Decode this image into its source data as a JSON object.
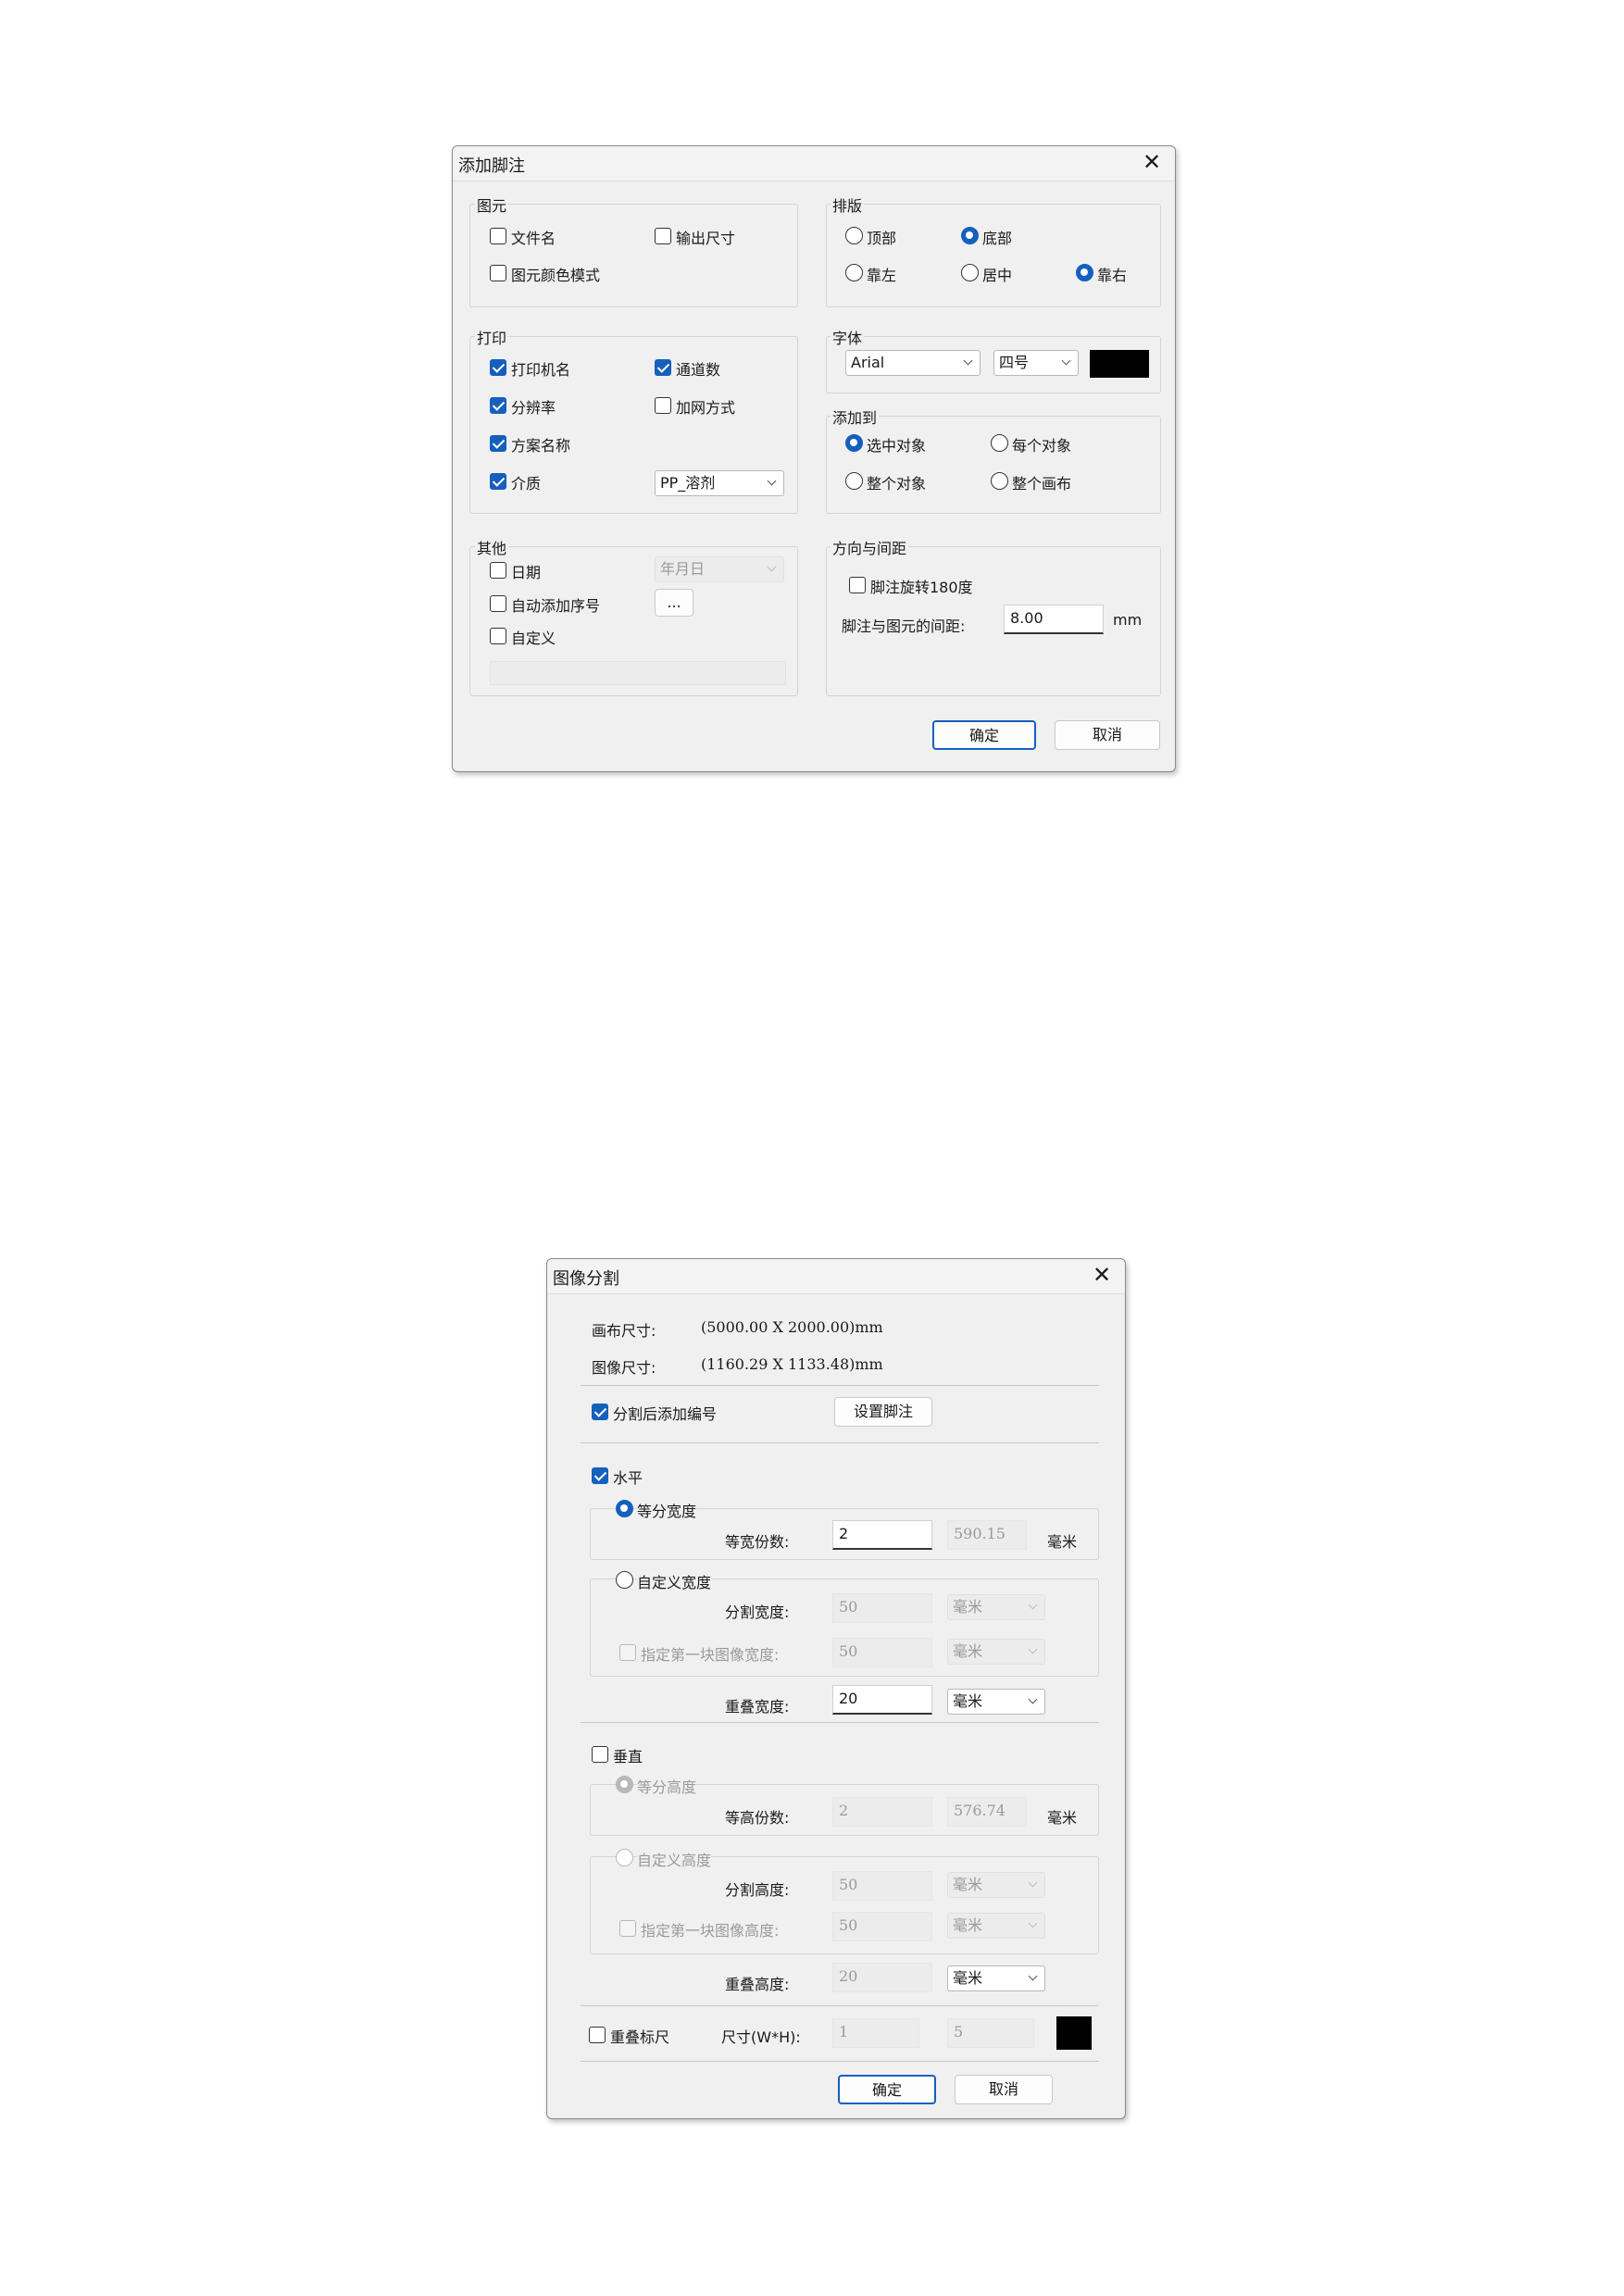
{
  "footnote_dialog": {
    "title": "添加脚注",
    "graphic_group": {
      "label": "图元",
      "file_name": "文件名",
      "output_size": "输出尺寸",
      "color_mode": "图元颜色模式"
    },
    "layout_group": {
      "label": "排版",
      "top": "顶部",
      "bottom": "底部",
      "left": "靠左",
      "center": "居中",
      "right": "靠右"
    },
    "print_group": {
      "label": "打印",
      "printer_name": "打印机名",
      "channels": "通道数",
      "resolution": "分辨率",
      "screening": "加网方式",
      "scheme_name": "方案名称",
      "media": "介质",
      "media_value": "PP_溶剂"
    },
    "font_group": {
      "label": "字体",
      "font_name": "Arial",
      "font_size": "四号",
      "color": "#000000"
    },
    "add_to_group": {
      "label": "添加到",
      "selected_objects": "选中对象",
      "each_object": "每个对象",
      "whole_object": "整个对象",
      "whole_canvas": "整个画布"
    },
    "other_group": {
      "label": "其他",
      "date": "日期",
      "date_format": "年月日",
      "auto_number": "自动添加序号",
      "ellipsis": "...",
      "custom": "自定义"
    },
    "direction_group": {
      "label": "方向与间距",
      "rotate": "脚注旋转180度",
      "spacing_label": "脚注与图元的间距:",
      "spacing_value": "8.00",
      "unit": "mm"
    },
    "ok": "确定",
    "cancel": "取消"
  },
  "split_dialog": {
    "title": "图像分割",
    "canvas_size_label": "画布尺寸:",
    "canvas_size_value": "(5000.00 X 2000.00)mm",
    "image_size_label": "图像尺寸:",
    "image_size_value": "(1160.29 X 1133.48)mm",
    "add_number": "分割后添加编号",
    "set_footnote": "设置脚注",
    "horizontal": {
      "label": "水平",
      "equal_width": "等分宽度",
      "equal_count_label": "等宽份数:",
      "equal_count_value": "2",
      "equal_result": "590.15",
      "unit": "毫米",
      "custom_width": "自定义宽度",
      "split_width_label": "分割宽度:",
      "split_width_value": "50",
      "split_width_unit": "毫米",
      "first_width_label": "指定第一块图像宽度:",
      "first_width_value": "50",
      "first_width_unit": "毫米",
      "overlap_label": "重叠宽度:",
      "overlap_value": "20",
      "overlap_unit": "毫米"
    },
    "vertical": {
      "label": "垂直",
      "equal_height": "等分高度",
      "equal_count_label": "等高份数:",
      "equal_count_value": "2",
      "equal_result": "576.74",
      "unit": "毫米",
      "custom_height": "自定义高度",
      "split_height_label": "分割高度:",
      "split_height_value": "50",
      "split_height_unit": "毫米",
      "first_height_label": "指定第一块图像高度:",
      "first_height_value": "50",
      "first_height_unit": "毫米",
      "overlap_label": "重叠高度:",
      "overlap_value": "20",
      "overlap_unit": "毫米"
    },
    "overlap_ruler": "重叠标尺",
    "size_label": "尺寸(W*H):",
    "size_w": "1",
    "size_h": "5",
    "ruler_color": "#000000",
    "ok": "确定",
    "cancel": "取消"
  }
}
